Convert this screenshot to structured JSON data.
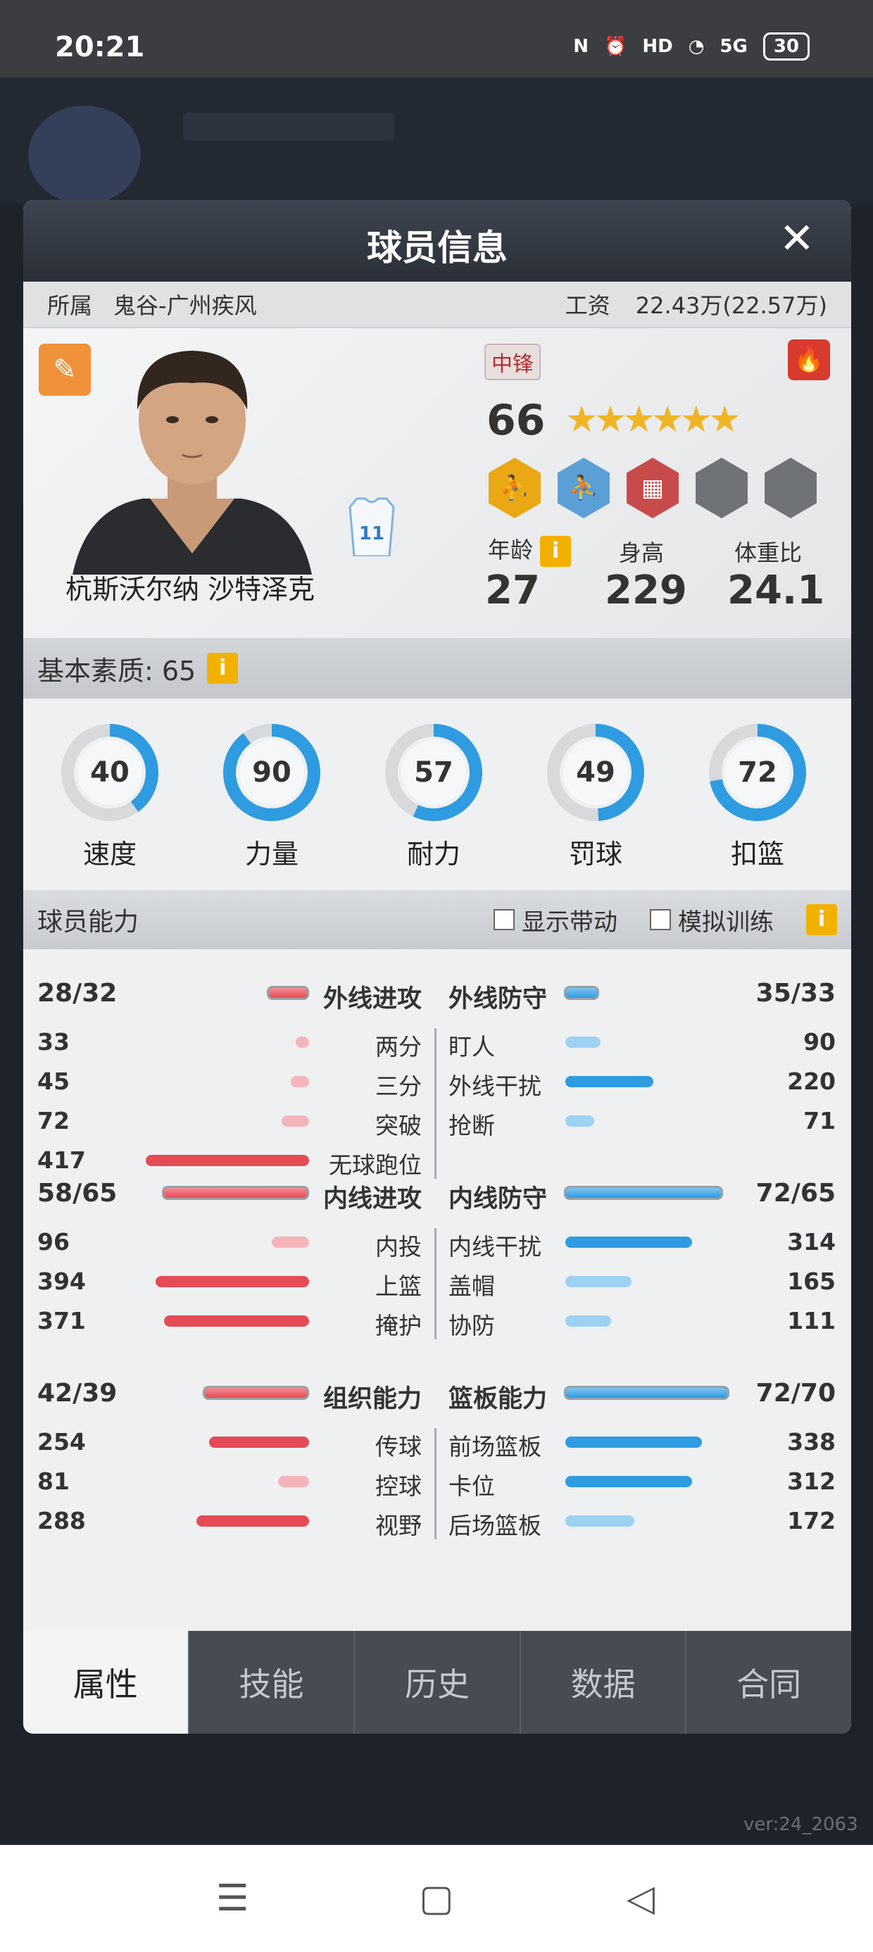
{
  "status": {
    "time": "20:21",
    "nfc": "N",
    "alarm": "⏰",
    "hd": "HD",
    "wifi": "◔",
    "signal": "5G",
    "battery": "30"
  },
  "modal": {
    "title": "球员信息",
    "close": "✕"
  },
  "team": {
    "label": "所属",
    "name": "鬼谷-广州疾风",
    "salary_label": "工资",
    "salary": "22.43万(22.57万)"
  },
  "player": {
    "name": "杭斯沃尔纳 沙特泽克",
    "jersey_number": "11",
    "position": "中锋",
    "overall": "66",
    "stars": "★★★★★★",
    "age_label": "年龄",
    "age": "27",
    "height_label": "身高",
    "height": "229",
    "weight_label": "体重比",
    "weight": "24.1"
  },
  "basic": {
    "label": "基本素质: 65",
    "info": "i"
  },
  "gauges": [
    {
      "value": "40",
      "label": "速度",
      "fraction": 0.4
    },
    {
      "value": "90",
      "label": "力量",
      "fraction": 0.9
    },
    {
      "value": "57",
      "label": "耐力",
      "fraction": 0.57
    },
    {
      "value": "49",
      "label": "罚球",
      "fraction": 0.49
    },
    {
      "value": "72",
      "label": "扣篮",
      "fraction": 0.72
    }
  ],
  "ability": {
    "title": "球员能力",
    "show_boost": "显示带动",
    "sim_train": "模拟训练",
    "info": "i"
  },
  "groups": [
    {
      "left": {
        "label": "外线进攻",
        "value": "28/32",
        "fill": 0.19
      },
      "right": {
        "label": "外线防守",
        "value": "35/33",
        "fill": 0.21
      },
      "left_rows": [
        {
          "label": "两分",
          "value": "33",
          "fill": 0.08
        },
        {
          "label": "三分",
          "value": "45",
          "fill": 0.11
        },
        {
          "label": "突破",
          "value": "72",
          "fill": 0.17
        },
        {
          "label": "无球跑位",
          "value": "417",
          "fill": 1.0
        }
      ],
      "right_rows": [
        {
          "label": "盯人",
          "value": "90",
          "fill": 0.21
        },
        {
          "label": "外线干扰",
          "value": "220",
          "fill": 0.52
        },
        {
          "label": "抢断",
          "value": "71",
          "fill": 0.17
        }
      ]
    },
    {
      "left": {
        "label": "内线进攻",
        "value": "58/65",
        "fill": 0.9
      },
      "right": {
        "label": "内线防守",
        "value": "72/65",
        "fill": 0.94
      },
      "left_rows": [
        {
          "label": "内投",
          "value": "96",
          "fill": 0.23
        },
        {
          "label": "上篮",
          "value": "394",
          "fill": 0.94
        },
        {
          "label": "掩护",
          "value": "371",
          "fill": 0.89
        }
      ],
      "right_rows": [
        {
          "label": "内线干扰",
          "value": "314",
          "fill": 0.75
        },
        {
          "label": "盖帽",
          "value": "165",
          "fill": 0.39
        },
        {
          "label": "协防",
          "value": "111",
          "fill": 0.27
        }
      ]
    },
    {
      "left": {
        "label": "组织能力",
        "value": "42/39",
        "fill": 0.65
      },
      "right": {
        "label": "篮板能力",
        "value": "72/70",
        "fill": 0.98
      },
      "left_rows": [
        {
          "label": "传球",
          "value": "254",
          "fill": 0.61
        },
        {
          "label": "控球",
          "value": "81",
          "fill": 0.19
        },
        {
          "label": "视野",
          "value": "288",
          "fill": 0.69
        }
      ],
      "right_rows": [
        {
          "label": "前场篮板",
          "value": "338",
          "fill": 0.81
        },
        {
          "label": "卡位",
          "value": "312",
          "fill": 0.75
        },
        {
          "label": "后场篮板",
          "value": "172",
          "fill": 0.41
        }
      ]
    }
  ],
  "tabs": [
    "属性",
    "技能",
    "历史",
    "数据",
    "合同"
  ],
  "version": "ver:24_2063",
  "colors": {
    "attack": "#e44b55",
    "defense": "#2f9be0",
    "gauge": "#2f9be0"
  }
}
